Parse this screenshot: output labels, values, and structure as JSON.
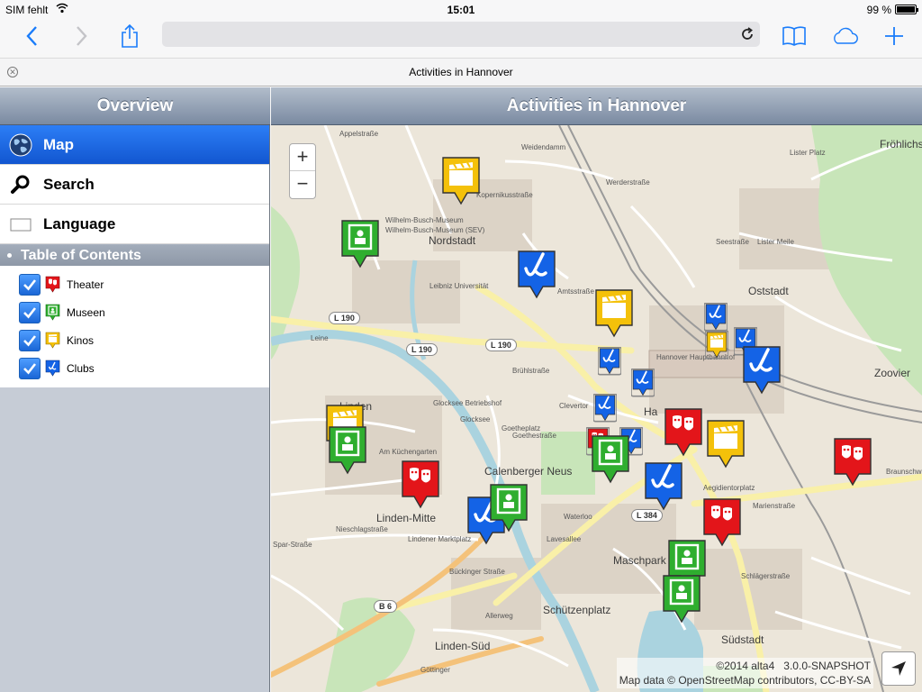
{
  "status_bar": {
    "carrier": "SIM fehlt",
    "time": "15:01",
    "battery": "99 %",
    "battery_level": 0.99
  },
  "browser": {
    "url": "",
    "tab_title": "Activities in Hannover"
  },
  "sidebar": {
    "title": "Overview",
    "menu": [
      {
        "label": "Map",
        "icon": "globe-icon",
        "selected": true
      },
      {
        "label": "Search",
        "icon": "magnifier-icon",
        "selected": false
      },
      {
        "label": "Language",
        "icon": "flag-icon",
        "selected": false
      }
    ],
    "toc_title": "Table of Contents",
    "layers": [
      {
        "label": "Theater",
        "checked": true,
        "color": "#e3151a",
        "icon": "theater-masks-icon"
      },
      {
        "label": "Museen",
        "checked": true,
        "color": "#2fae2f",
        "icon": "museum-icon"
      },
      {
        "label": "Kinos",
        "checked": true,
        "color": "#f4c10a",
        "icon": "clapperboard-icon"
      },
      {
        "label": "Clubs",
        "checked": true,
        "color": "#1463e6",
        "icon": "saxophone-icon"
      }
    ]
  },
  "map": {
    "title": "Activities in Hannover",
    "zoom_in": "+",
    "zoom_out": "−",
    "places": [
      "Nordstadt",
      "Oststadt",
      "Zoovier",
      "Calenberger Neus",
      "Linden-Mitte",
      "Maschpark",
      "Schützenplatz",
      "Südstadt",
      "Linden-Süd",
      "Ha",
      "Linden",
      "Fröhlichs Lo"
    ],
    "streets": [
      "Appelstraße",
      "Kopernikusstraße",
      "Wilhelm-Busch-Museum",
      "Wilhelm-Busch-Museum (SEV)",
      "Leibniz Universität",
      "Werderstraße",
      "Lister Platz",
      "Seestraße",
      "Lister Meile",
      "Amtsstraße",
      "Brühlstraße",
      "Goethestraße",
      "Goetheplatz",
      "Am Küchengarten",
      "Nieschlagstraße",
      "Lindener Marktplatz",
      "Bückinger Straße",
      "Waterloo",
      "Aegidientorplatz",
      "Marienstraße",
      "Schlägerstraße",
      "Braunschw",
      "Hannover Hauptbahnhof",
      "Glocksee",
      "Glocksee Betriebshof",
      "Clevertor",
      "Lavesallee",
      "Allerweg",
      "Göttinger",
      "Leine",
      "Weidendamm",
      "Kopernikusstraße",
      "Spar-Straße"
    ],
    "road_badges": [
      "L 190",
      "L 190",
      "L 190",
      "L 384",
      "B 6"
    ],
    "attribution_line1": "©2014 alta4",
    "version": "3.0.0-SNAPSHOT",
    "attribution_line2": "Map data © OpenStreetMap contributors, CC-BY-SA"
  }
}
